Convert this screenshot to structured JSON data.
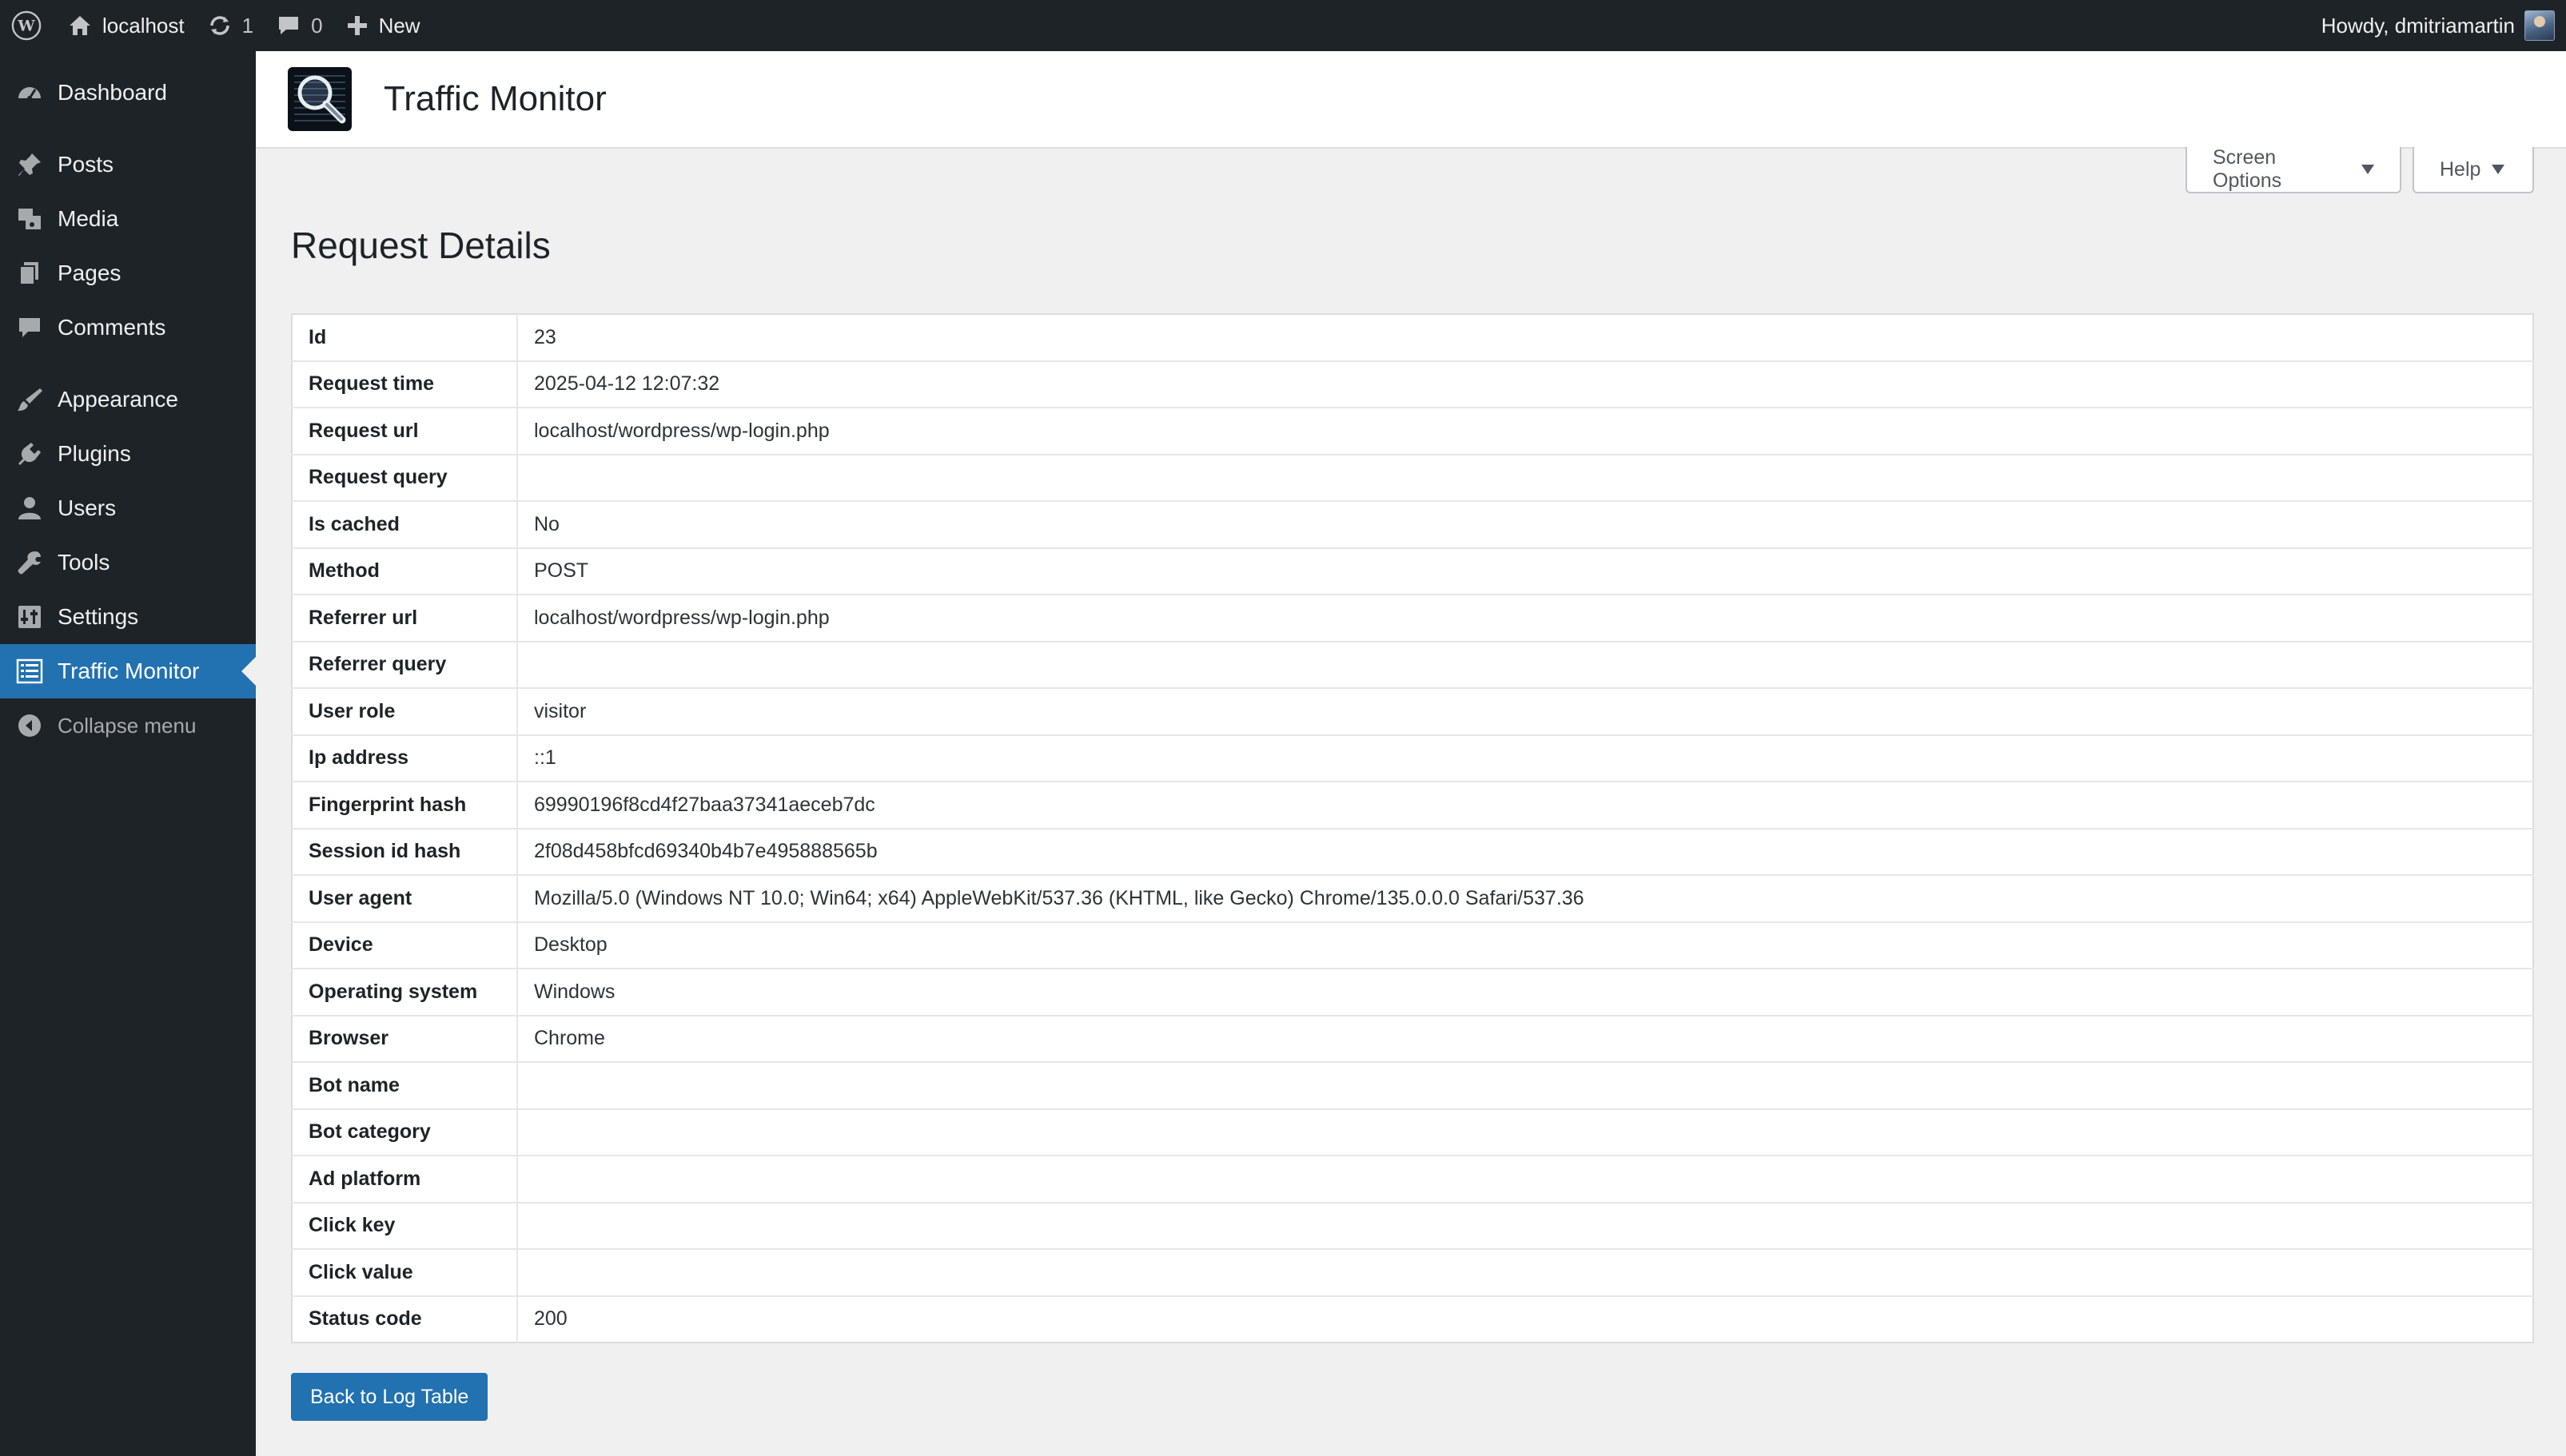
{
  "adminbar": {
    "site_name": "localhost",
    "updates_count": "1",
    "comments_count": "0",
    "new_label": "New",
    "howdy": "Howdy, dmitriamartin"
  },
  "sidebar": {
    "items": [
      {
        "label": "Dashboard",
        "icon": "dashboard-icon"
      },
      {
        "label": "Posts",
        "icon": "pin-icon"
      },
      {
        "label": "Media",
        "icon": "media-icon"
      },
      {
        "label": "Pages",
        "icon": "pages-icon"
      },
      {
        "label": "Comments",
        "icon": "comment-icon"
      },
      {
        "label": "Appearance",
        "icon": "brush-icon"
      },
      {
        "label": "Plugins",
        "icon": "plugin-icon"
      },
      {
        "label": "Users",
        "icon": "user-icon"
      },
      {
        "label": "Tools",
        "icon": "wrench-icon"
      },
      {
        "label": "Settings",
        "icon": "settings-icon"
      },
      {
        "label": "Traffic Monitor",
        "icon": "list-icon"
      }
    ],
    "collapse_label": "Collapse menu"
  },
  "header": {
    "title": "Traffic Monitor"
  },
  "screen_options_label": "Screen Options",
  "help_label": "Help",
  "page_title": "Request Details",
  "details": [
    {
      "key": "Id",
      "value": "23"
    },
    {
      "key": "Request time",
      "value": "2025-04-12 12:07:32"
    },
    {
      "key": "Request url",
      "value": "localhost/wordpress/wp-login.php"
    },
    {
      "key": "Request query",
      "value": ""
    },
    {
      "key": "Is cached",
      "value": "No"
    },
    {
      "key": "Method",
      "value": "POST"
    },
    {
      "key": "Referrer url",
      "value": "localhost/wordpress/wp-login.php"
    },
    {
      "key": "Referrer query",
      "value": ""
    },
    {
      "key": "User role",
      "value": "visitor"
    },
    {
      "key": "Ip address",
      "value": "::1"
    },
    {
      "key": "Fingerprint hash",
      "value": "69990196f8cd4f27baa37341aeceb7dc"
    },
    {
      "key": "Session id hash",
      "value": "2f08d458bfcd69340b4b7e495888565b"
    },
    {
      "key": "User agent",
      "value": "Mozilla/5.0 (Windows NT 10.0; Win64; x64) AppleWebKit/537.36 (KHTML, like Gecko) Chrome/135.0.0.0 Safari/537.36"
    },
    {
      "key": "Device",
      "value": "Desktop"
    },
    {
      "key": "Operating system",
      "value": "Windows"
    },
    {
      "key": "Browser",
      "value": "Chrome"
    },
    {
      "key": "Bot name",
      "value": ""
    },
    {
      "key": "Bot category",
      "value": ""
    },
    {
      "key": "Ad platform",
      "value": ""
    },
    {
      "key": "Click key",
      "value": ""
    },
    {
      "key": "Click value",
      "value": ""
    },
    {
      "key": "Status code",
      "value": "200"
    }
  ],
  "back_button_label": "Back to Log Table",
  "colors": {
    "accent": "#2271b1",
    "sidebar_bg": "#1d2327",
    "page_bg": "#f0f0f1"
  }
}
